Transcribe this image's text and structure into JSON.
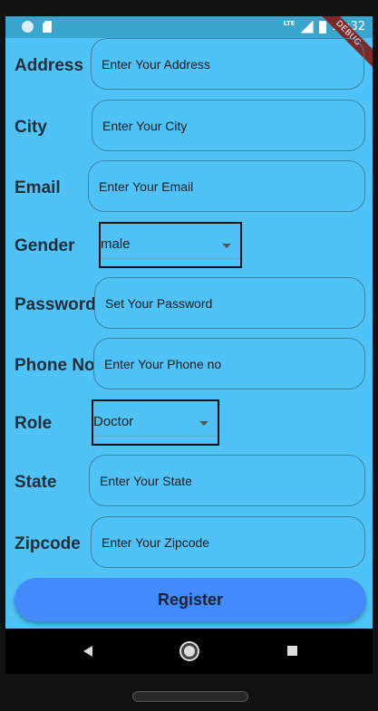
{
  "status_bar": {
    "network": "LTE",
    "time": "11:32"
  },
  "debug_banner": "DEBUG",
  "form": {
    "address": {
      "label": "Address",
      "placeholder": "Enter Your Address"
    },
    "city": {
      "label": "City",
      "placeholder": "Enter Your City"
    },
    "email": {
      "label": "Email",
      "placeholder": "Enter Your Email"
    },
    "gender": {
      "label": "Gender",
      "value": "male"
    },
    "password": {
      "label": "Password",
      "placeholder": "Set Your Password"
    },
    "phone": {
      "label": "Phone No",
      "placeholder": "Enter Your Phone no"
    },
    "role": {
      "label": "Role",
      "value": "Doctor"
    },
    "state": {
      "label": "State",
      "placeholder": "Enter Your State"
    },
    "zipcode": {
      "label": "Zipcode",
      "placeholder": "Enter Your Zipcode"
    }
  },
  "register_button": "Register",
  "colors": {
    "background": "#4fc3f7",
    "status_bar": "#3aa6d0",
    "button": "#448aff",
    "field_border": "#3a82a6"
  },
  "icons": {
    "dropdown": "arrow-drop-down-icon",
    "nav_back": "triangle-back-icon",
    "nav_home": "circle-home-icon",
    "nav_recent": "square-recents-icon"
  }
}
